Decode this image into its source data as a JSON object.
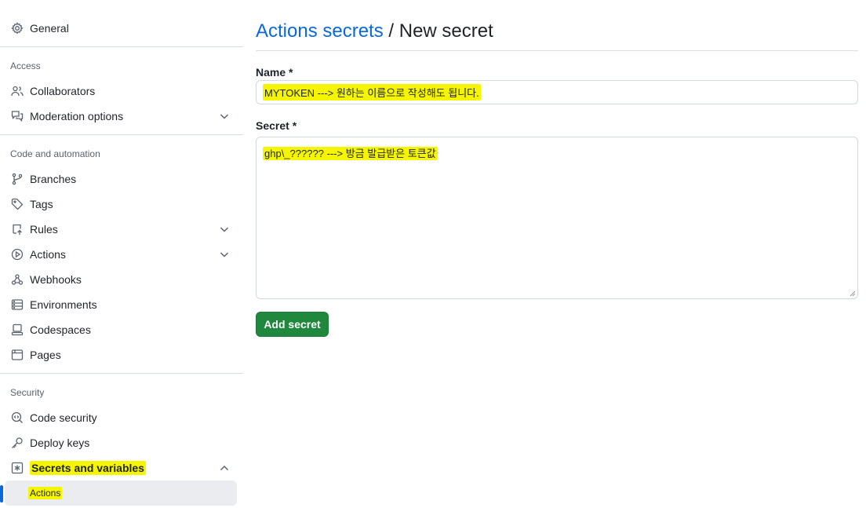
{
  "sidebar": {
    "general": {
      "label": "General",
      "icon": "gear-icon"
    },
    "sections": {
      "access": "Access",
      "code_automation": "Code and automation",
      "security": "Security"
    },
    "items": {
      "collaborators": {
        "label": "Collaborators",
        "icon": "people-icon"
      },
      "moderation": {
        "label": "Moderation options",
        "icon": "comment-discussion-icon"
      },
      "branches": {
        "label": "Branches",
        "icon": "git-branch-icon"
      },
      "tags": {
        "label": "Tags",
        "icon": "tag-icon"
      },
      "rules": {
        "label": "Rules",
        "icon": "repo-push-icon"
      },
      "actions": {
        "label": "Actions",
        "icon": "play-icon"
      },
      "webhooks": {
        "label": "Webhooks",
        "icon": "webhook-icon"
      },
      "environments": {
        "label": "Environments",
        "icon": "server-icon"
      },
      "codespaces": {
        "label": "Codespaces",
        "icon": "codespaces-icon"
      },
      "pages": {
        "label": "Pages",
        "icon": "browser-icon"
      },
      "code_security": {
        "label": "Code security",
        "icon": "codescan-icon"
      },
      "deploy_keys": {
        "label": "Deploy keys",
        "icon": "key-icon"
      },
      "secrets_variables": {
        "label": "Secrets and variables",
        "icon": "asterisk-icon"
      },
      "secrets_actions": {
        "label": "Actions"
      }
    }
  },
  "main": {
    "breadcrumb_link": "Actions secrets",
    "breadcrumb_sep": "/",
    "title": "New secret",
    "name_label": "Name *",
    "name_value": "MYTOKEN ---> 원하는 이름으로 작성해도 됩니다.",
    "secret_label": "Secret *",
    "secret_value": "ghp\\_?????? ---> 방금 발급받은 토큰값",
    "submit_label": "Add secret"
  },
  "colors": {
    "accent": "#0969da",
    "primary_button": "#1f883d",
    "highlight": "#f5f500"
  }
}
